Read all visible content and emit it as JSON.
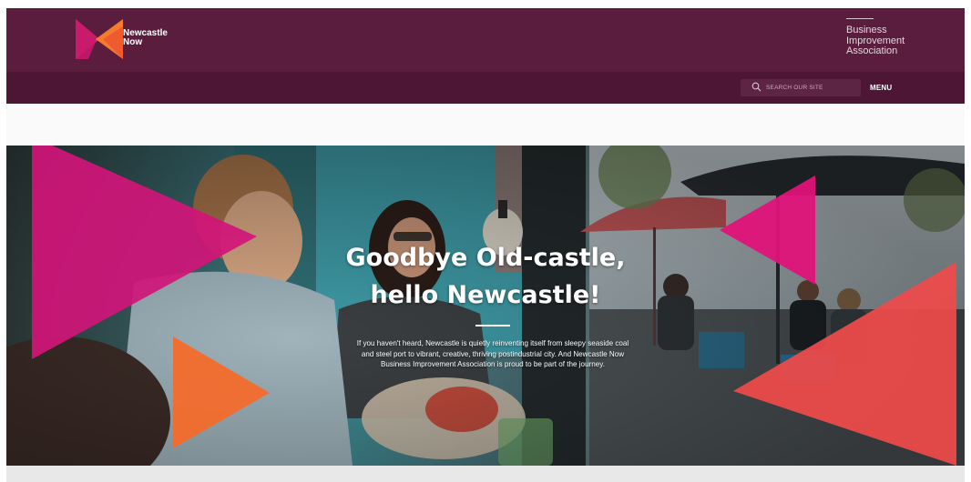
{
  "header": {
    "logo_text_line1": "Newcastle",
    "logo_text_line2": "Now",
    "bia_text": "Business\nImprovement\nAssociation",
    "colors": {
      "header_bg": "#5a1d3e",
      "nav_bg": "#4c1634",
      "accent_pink": "#d11e79",
      "accent_orange": "#f36b2c"
    }
  },
  "nav": {
    "search": {
      "icon": "search-icon",
      "placeholder": "SEARCH OUR SITE",
      "value": ""
    },
    "menu_label": "MENU"
  },
  "hero": {
    "title_line1": "Goodbye Old-castle,",
    "title_line2": "hello Newcastle!",
    "body": "If you haven't heard, Newcastle is quietly reinventing itself from sleepy seaside coal and steel port to vibrant, creative, thriving postindustrial city. And Newcastle Now Business Improvement Association is proud to be part of the journey."
  }
}
